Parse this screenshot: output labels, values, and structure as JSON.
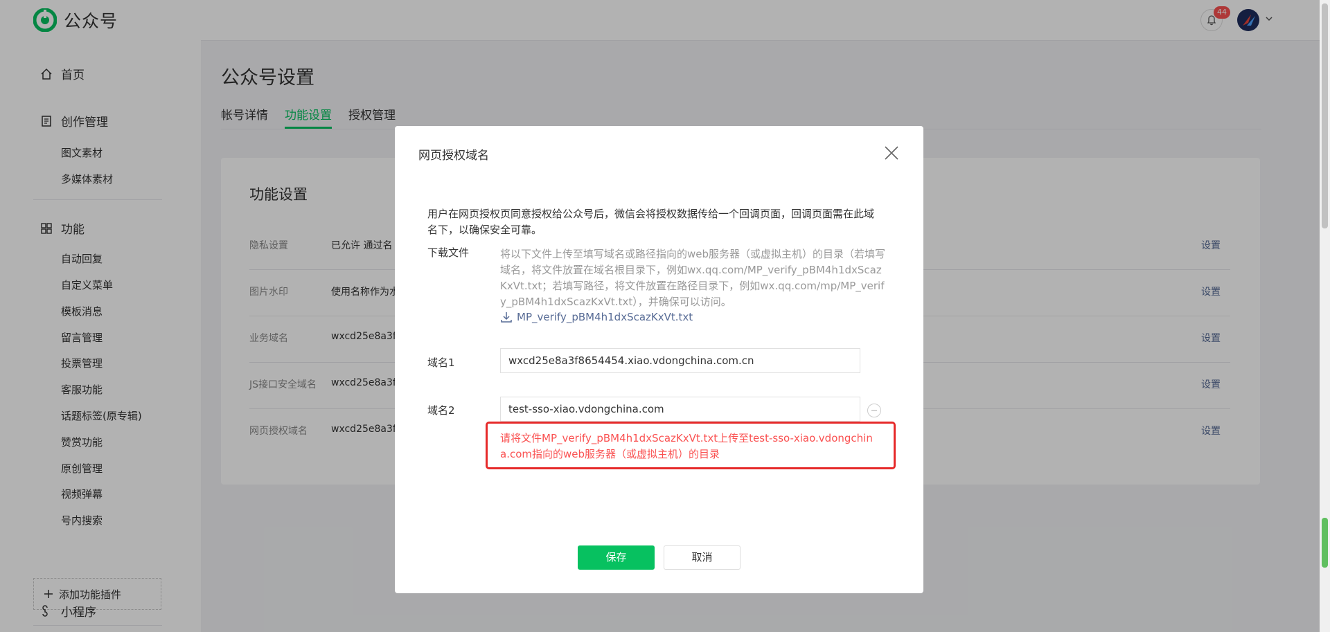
{
  "header": {
    "app_name": "公众号",
    "notification_count": "44",
    "brand_color": "#07c160"
  },
  "sidebar": {
    "home": "首页",
    "creation": {
      "label": "创作管理",
      "items": [
        "图文素材",
        "多媒体素材"
      ]
    },
    "features": {
      "label": "功能",
      "items": [
        "自动回复",
        "自定义菜单",
        "模板消息",
        "留言管理",
        "投票管理",
        "客服功能",
        "话题标签(原专辑)",
        "赞赏功能",
        "原创管理",
        "视频弹幕",
        "号内搜索"
      ]
    },
    "add_plugin": "添加功能插件",
    "mini_program": "小程序"
  },
  "main": {
    "title": "公众号设置",
    "tabs": [
      "帐号详情",
      "功能设置",
      "授权管理"
    ],
    "active_tab": "功能设置",
    "card_title": "功能设置",
    "rows": [
      {
        "label": "隐私设置",
        "value": "已允许 通过名",
        "action": "设置"
      },
      {
        "label": "图片水印",
        "value": "使用名称作为水",
        "action": "设置"
      },
      {
        "label": "业务域名",
        "value": "wxcd25e8a3f",
        "action": "设置"
      },
      {
        "label": "JS接口安全域名",
        "value": "wxcd25e8a3f",
        "action": "设置"
      },
      {
        "label": "网页授权域名",
        "value": "wxcd25e8a3f",
        "action": "设置"
      }
    ]
  },
  "dialog": {
    "title": "网页授权域名",
    "description": "用户在网页授权页同意授权给公众号后，微信会将授权数据传给一个回调页面，回调页面需在此域名下，以确保安全可靠。",
    "download_label": "下载文件",
    "download_text": "将以下文件上传至填写域名或路径指向的web服务器（或虚拟主机）的目录（若填写域名，将文件放置在域名根目录下，例如wx.qq.com/MP_verify_pBM4h1dxScazKxVt.txt；若填写路径，将文件放置在路径目录下，例如wx.qq.com/mp/MP_verify_pBM4h1dxScazKxVt.txt），并确保可以访问。",
    "download_file": "MP_verify_pBM4h1dxScazKxVt.txt",
    "domain1_label": "域名1",
    "domain1_value": "wxcd25e8a3f8654454.xiao.vdongchina.com.cn",
    "domain2_label": "域名2",
    "domain2_value": "test-sso-xiao.vdongchina.com",
    "error_text": "请将文件MP_verify_pBM4h1dxScazKxVt.txt上传至test-sso-xiao.vdongchina.com指向的web服务器（或虚拟主机）的目录",
    "error_color": "#fa5151",
    "save_label": "保存",
    "cancel_label": "取消"
  }
}
